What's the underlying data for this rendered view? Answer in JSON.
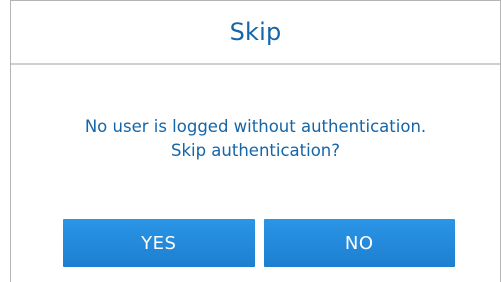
{
  "dialog": {
    "title": "Skip",
    "message_line1": "No user is logged without authentication.",
    "message_line2": "Skip authentication?"
  },
  "buttons": {
    "yes_label": "YES",
    "no_label": "NO"
  },
  "colors": {
    "accent_text": "#1565a8",
    "button_fill": "#1f86d8",
    "divider": "#cfcfcf"
  }
}
